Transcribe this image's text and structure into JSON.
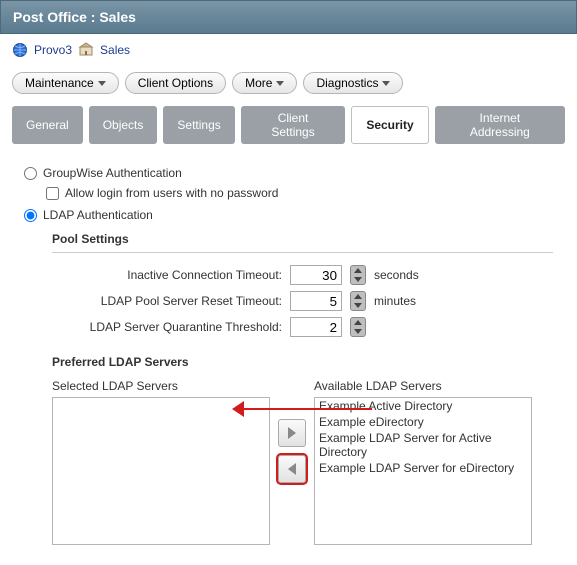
{
  "header": {
    "title": "Post Office : Sales"
  },
  "breadcrumb": {
    "org": "Provo3",
    "po": "Sales"
  },
  "toolbar": {
    "maintenance": "Maintenance",
    "client_options": "Client Options",
    "more": "More",
    "diagnostics": "Diagnostics"
  },
  "tabs": {
    "general": "General",
    "objects": "Objects",
    "settings": "Settings",
    "client_settings": "Client Settings",
    "security": "Security",
    "internet": "Internet Addressing"
  },
  "auth": {
    "groupwise_label": "GroupWise Authentication",
    "nopass_label": "Allow login from users with no password",
    "ldap_label": "LDAP Authentication",
    "selected": "ldap"
  },
  "pool": {
    "heading": "Pool Settings",
    "inactive_label": "Inactive Connection Timeout:",
    "inactive_val": "30",
    "inactive_unit": "seconds",
    "reset_label": "LDAP Pool Server Reset Timeout:",
    "reset_val": "5",
    "reset_unit": "minutes",
    "quarantine_label": "LDAP Server Quarantine Threshold:",
    "quarantine_val": "2"
  },
  "ldap_lists": {
    "heading": "Preferred LDAP Servers",
    "selected_label": "Selected LDAP Servers",
    "available_label": "Available LDAP Servers",
    "available": [
      "Example Active Directory",
      "Example eDirectory",
      "Example LDAP Server for Active Directory",
      "Example LDAP Server for eDirectory"
    ]
  }
}
